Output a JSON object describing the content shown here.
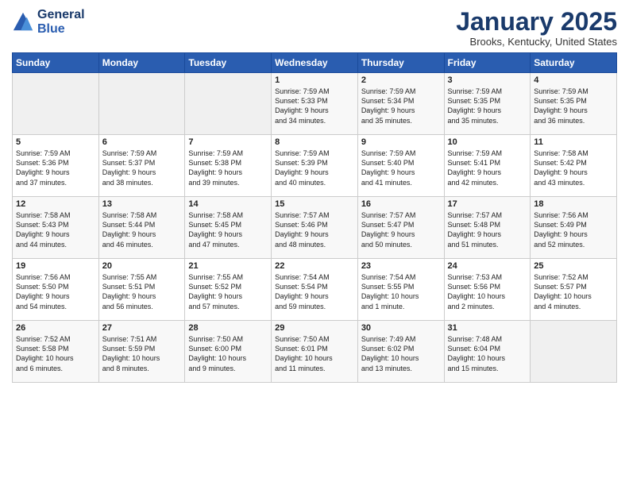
{
  "header": {
    "logo_line1": "General",
    "logo_line2": "Blue",
    "title": "January 2025",
    "location": "Brooks, Kentucky, United States"
  },
  "days_of_week": [
    "Sunday",
    "Monday",
    "Tuesday",
    "Wednesday",
    "Thursday",
    "Friday",
    "Saturday"
  ],
  "weeks": [
    [
      {
        "day": "",
        "empty": true
      },
      {
        "day": "",
        "empty": true
      },
      {
        "day": "",
        "empty": true
      },
      {
        "day": "1",
        "text": "Sunrise: 7:59 AM\nSunset: 5:33 PM\nDaylight: 9 hours\nand 34 minutes."
      },
      {
        "day": "2",
        "text": "Sunrise: 7:59 AM\nSunset: 5:34 PM\nDaylight: 9 hours\nand 35 minutes."
      },
      {
        "day": "3",
        "text": "Sunrise: 7:59 AM\nSunset: 5:35 PM\nDaylight: 9 hours\nand 35 minutes."
      },
      {
        "day": "4",
        "text": "Sunrise: 7:59 AM\nSunset: 5:35 PM\nDaylight: 9 hours\nand 36 minutes."
      }
    ],
    [
      {
        "day": "5",
        "text": "Sunrise: 7:59 AM\nSunset: 5:36 PM\nDaylight: 9 hours\nand 37 minutes."
      },
      {
        "day": "6",
        "text": "Sunrise: 7:59 AM\nSunset: 5:37 PM\nDaylight: 9 hours\nand 38 minutes."
      },
      {
        "day": "7",
        "text": "Sunrise: 7:59 AM\nSunset: 5:38 PM\nDaylight: 9 hours\nand 39 minutes."
      },
      {
        "day": "8",
        "text": "Sunrise: 7:59 AM\nSunset: 5:39 PM\nDaylight: 9 hours\nand 40 minutes."
      },
      {
        "day": "9",
        "text": "Sunrise: 7:59 AM\nSunset: 5:40 PM\nDaylight: 9 hours\nand 41 minutes."
      },
      {
        "day": "10",
        "text": "Sunrise: 7:59 AM\nSunset: 5:41 PM\nDaylight: 9 hours\nand 42 minutes."
      },
      {
        "day": "11",
        "text": "Sunrise: 7:58 AM\nSunset: 5:42 PM\nDaylight: 9 hours\nand 43 minutes."
      }
    ],
    [
      {
        "day": "12",
        "text": "Sunrise: 7:58 AM\nSunset: 5:43 PM\nDaylight: 9 hours\nand 44 minutes."
      },
      {
        "day": "13",
        "text": "Sunrise: 7:58 AM\nSunset: 5:44 PM\nDaylight: 9 hours\nand 46 minutes."
      },
      {
        "day": "14",
        "text": "Sunrise: 7:58 AM\nSunset: 5:45 PM\nDaylight: 9 hours\nand 47 minutes."
      },
      {
        "day": "15",
        "text": "Sunrise: 7:57 AM\nSunset: 5:46 PM\nDaylight: 9 hours\nand 48 minutes."
      },
      {
        "day": "16",
        "text": "Sunrise: 7:57 AM\nSunset: 5:47 PM\nDaylight: 9 hours\nand 50 minutes."
      },
      {
        "day": "17",
        "text": "Sunrise: 7:57 AM\nSunset: 5:48 PM\nDaylight: 9 hours\nand 51 minutes."
      },
      {
        "day": "18",
        "text": "Sunrise: 7:56 AM\nSunset: 5:49 PM\nDaylight: 9 hours\nand 52 minutes."
      }
    ],
    [
      {
        "day": "19",
        "text": "Sunrise: 7:56 AM\nSunset: 5:50 PM\nDaylight: 9 hours\nand 54 minutes."
      },
      {
        "day": "20",
        "text": "Sunrise: 7:55 AM\nSunset: 5:51 PM\nDaylight: 9 hours\nand 56 minutes."
      },
      {
        "day": "21",
        "text": "Sunrise: 7:55 AM\nSunset: 5:52 PM\nDaylight: 9 hours\nand 57 minutes."
      },
      {
        "day": "22",
        "text": "Sunrise: 7:54 AM\nSunset: 5:54 PM\nDaylight: 9 hours\nand 59 minutes."
      },
      {
        "day": "23",
        "text": "Sunrise: 7:54 AM\nSunset: 5:55 PM\nDaylight: 10 hours\nand 1 minute."
      },
      {
        "day": "24",
        "text": "Sunrise: 7:53 AM\nSunset: 5:56 PM\nDaylight: 10 hours\nand 2 minutes."
      },
      {
        "day": "25",
        "text": "Sunrise: 7:52 AM\nSunset: 5:57 PM\nDaylight: 10 hours\nand 4 minutes."
      }
    ],
    [
      {
        "day": "26",
        "text": "Sunrise: 7:52 AM\nSunset: 5:58 PM\nDaylight: 10 hours\nand 6 minutes."
      },
      {
        "day": "27",
        "text": "Sunrise: 7:51 AM\nSunset: 5:59 PM\nDaylight: 10 hours\nand 8 minutes."
      },
      {
        "day": "28",
        "text": "Sunrise: 7:50 AM\nSunset: 6:00 PM\nDaylight: 10 hours\nand 9 minutes."
      },
      {
        "day": "29",
        "text": "Sunrise: 7:50 AM\nSunset: 6:01 PM\nDaylight: 10 hours\nand 11 minutes."
      },
      {
        "day": "30",
        "text": "Sunrise: 7:49 AM\nSunset: 6:02 PM\nDaylight: 10 hours\nand 13 minutes."
      },
      {
        "day": "31",
        "text": "Sunrise: 7:48 AM\nSunset: 6:04 PM\nDaylight: 10 hours\nand 15 minutes."
      },
      {
        "day": "",
        "empty": true
      }
    ]
  ]
}
